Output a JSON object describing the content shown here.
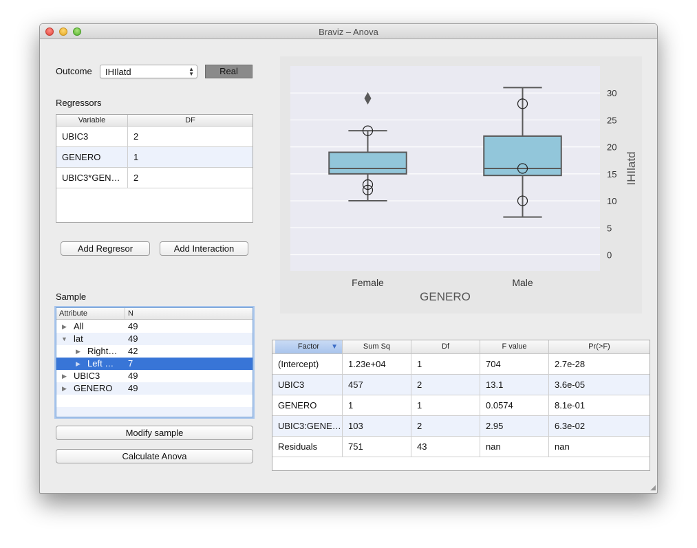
{
  "window": {
    "title": "Braviz – Anova"
  },
  "outcome": {
    "label": "Outcome",
    "selected": "IHIlatd",
    "type_button": "Real"
  },
  "regressors": {
    "label": "Regressors",
    "headers": [
      "Variable",
      "DF"
    ],
    "rows": [
      {
        "variable": "UBIC3",
        "df": "2"
      },
      {
        "variable": "GENERO",
        "df": "1"
      },
      {
        "variable": "UBIC3*GEN…",
        "df": "2"
      }
    ],
    "add_regressor": "Add Regresor",
    "add_interaction": "Add Interaction"
  },
  "sample": {
    "label": "Sample",
    "headers": [
      "Attribute",
      "N"
    ],
    "rows": [
      {
        "name": "All",
        "n": "49",
        "indent": 0,
        "expanded": false
      },
      {
        "name": "lat",
        "n": "49",
        "indent": 0,
        "expanded": true
      },
      {
        "name": "Right…",
        "n": "42",
        "indent": 1,
        "expanded": false
      },
      {
        "name": "Left …",
        "n": "7",
        "indent": 1,
        "expanded": false
      },
      {
        "name": "UBIC3",
        "n": "49",
        "indent": 0,
        "expanded": false
      },
      {
        "name": "GENERO",
        "n": "49",
        "indent": 0,
        "expanded": false
      }
    ],
    "selected_index": 3,
    "modify_button": "Modify sample",
    "calculate_button": "Calculate Anova"
  },
  "anova_table": {
    "headers": [
      "Factor",
      "Sum Sq",
      "Df",
      "F value",
      "Pr(>F)"
    ],
    "rows": [
      [
        "(Intercept)",
        "1.23e+04",
        "1",
        "704",
        "2.7e-28"
      ],
      [
        "UBIC3",
        "457",
        "2",
        "13.1",
        "3.6e-05"
      ],
      [
        "GENERO",
        "1",
        "1",
        "0.0574",
        "8.1e-01"
      ],
      [
        "UBIC3:GENE…",
        "103",
        "2",
        "2.95",
        "6.3e-02"
      ],
      [
        "Residuals",
        "751",
        "43",
        "nan",
        "nan"
      ]
    ]
  },
  "colors": {
    "box_fill": "#92c6da",
    "box_stroke": "#5a5a5a",
    "plot_bg": "#eaeaf2",
    "selection": "#3875d7"
  },
  "chart_data": {
    "type": "box",
    "xlabel": "GENERO",
    "ylabel": "IHIlatd",
    "categories": [
      "Female",
      "Male"
    ],
    "ylim": [
      -3,
      35
    ],
    "yticks": [
      "0",
      "5",
      "10",
      "15",
      "20",
      "25",
      "30"
    ],
    "grid": true,
    "y_axis_side": "right",
    "boxes": [
      {
        "name": "Female",
        "q1": 15,
        "median": 16,
        "q3": 19,
        "whisker_low": 10,
        "whisker_high": 23,
        "fliers": [
          29
        ],
        "points": [
          23,
          13,
          12
        ]
      },
      {
        "name": "Male",
        "q1": 14.7,
        "median": 16,
        "q3": 22,
        "whisker_low": 7,
        "whisker_high": 31,
        "fliers": [],
        "points": [
          28,
          16,
          10
        ]
      }
    ]
  }
}
